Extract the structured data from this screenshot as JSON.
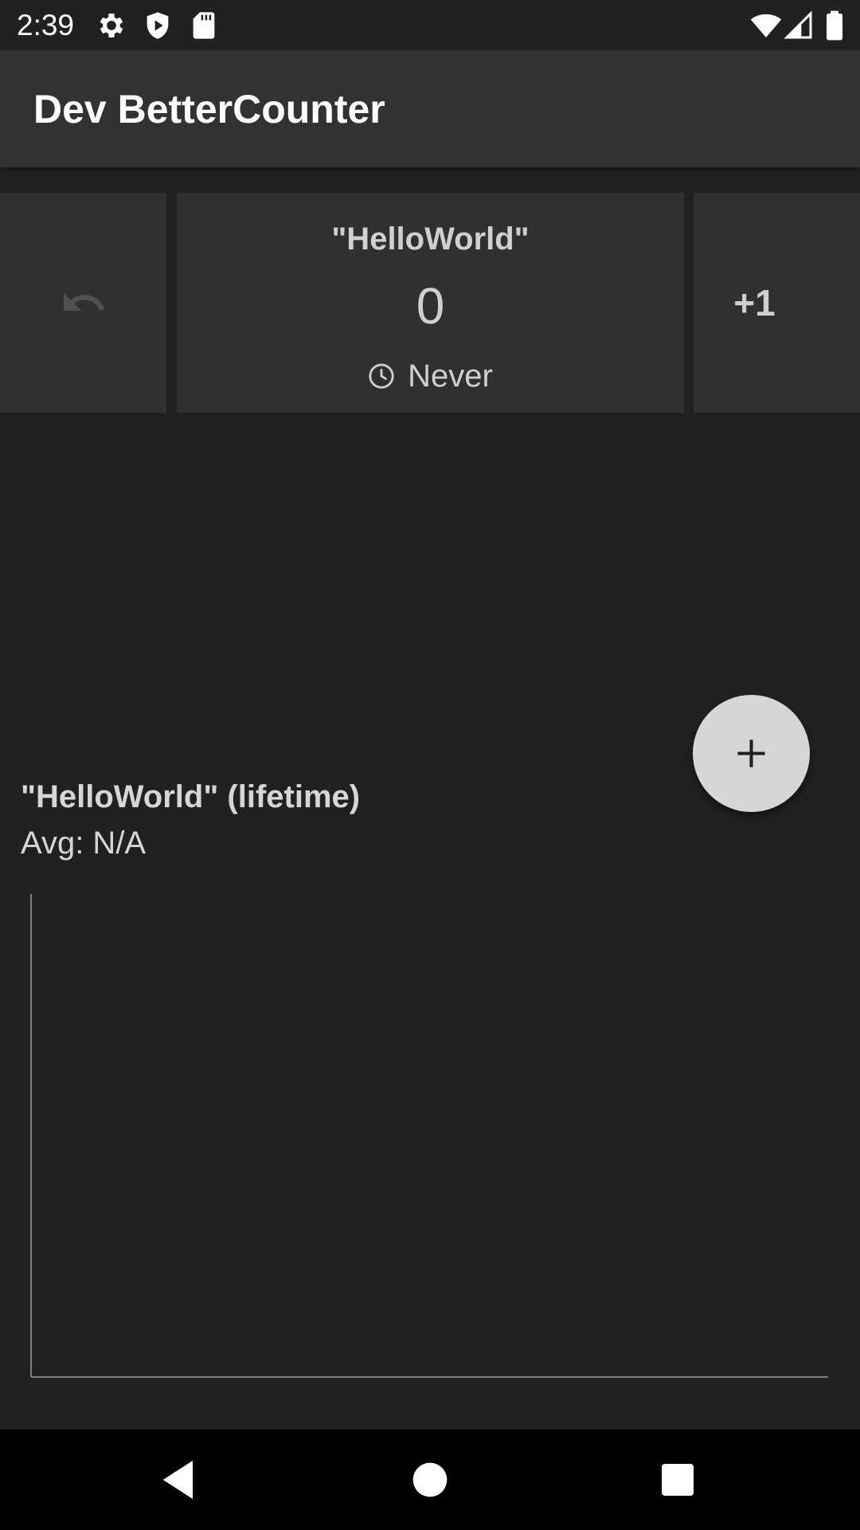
{
  "status_bar": {
    "time": "2:39",
    "left_icons": [
      "settings-icon",
      "shield-icon",
      "sd-card-icon"
    ],
    "right_icons": [
      "wifi-icon",
      "signal-icon",
      "battery-icon"
    ]
  },
  "app_bar": {
    "title": "Dev BetterCounter"
  },
  "counter": {
    "name": "\"HelloWorld\"",
    "value": "0",
    "last_increment": "Never",
    "increment_label": "+1",
    "undo_icon": "undo-icon",
    "clock_icon": "clock-icon"
  },
  "fab": {
    "icon": "plus-icon"
  },
  "stats": {
    "title": "\"HelloWorld\" (lifetime)",
    "average": "Avg: N/A"
  },
  "chart_data": {
    "type": "line",
    "series": [],
    "title": "",
    "xlabel": "",
    "ylabel": "",
    "grid": false
  },
  "nav_bar": {
    "buttons": [
      "back-icon",
      "home-icon",
      "recents-icon"
    ]
  },
  "colors": {
    "background": "#212121",
    "app_bar": "#323232",
    "card": "#303030",
    "fab": "#d6d6d6",
    "text_secondary": "#d0d0d0"
  }
}
